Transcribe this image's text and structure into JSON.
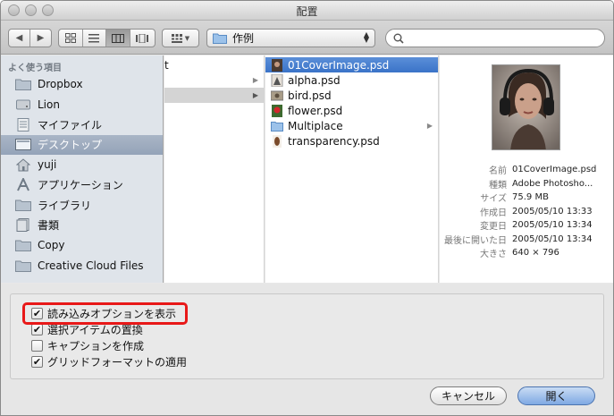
{
  "window": {
    "title": "配置"
  },
  "toolbar": {
    "path_folder": "作例",
    "search_placeholder": ""
  },
  "sidebar": {
    "header": "よく使う項目",
    "items": [
      {
        "label": "Dropbox",
        "icon": "folder-icon"
      },
      {
        "label": "Lion",
        "icon": "hard-drive-icon"
      },
      {
        "label": "マイファイル",
        "icon": "all-my-files-icon"
      },
      {
        "label": "デスクトップ",
        "icon": "desktop-icon",
        "selected": true
      },
      {
        "label": "yuji",
        "icon": "home-icon"
      },
      {
        "label": "アプリケーション",
        "icon": "applications-icon"
      },
      {
        "label": "ライブラリ",
        "icon": "folder-icon"
      },
      {
        "label": "書類",
        "icon": "documents-icon"
      },
      {
        "label": "Copy",
        "icon": "folder-icon"
      },
      {
        "label": "Creative Cloud Files",
        "icon": "folder-icon"
      }
    ]
  },
  "column1": {
    "partial_text": "t"
  },
  "column2": {
    "items": [
      {
        "label": "01CoverImage.psd",
        "icon": "psd-thumb-icon",
        "selected": true
      },
      {
        "label": "alpha.psd",
        "icon": "psd-thumb-icon"
      },
      {
        "label": "bird.psd",
        "icon": "psd-thumb-icon"
      },
      {
        "label": "flower.psd",
        "icon": "psd-thumb-icon"
      },
      {
        "label": "Multiplace",
        "icon": "folder-icon",
        "folder": true
      },
      {
        "label": "transparency.psd",
        "icon": "psd-thumb-icon"
      }
    ]
  },
  "preview": {
    "info": [
      {
        "key": "名前",
        "value": "01CoverImage.psd"
      },
      {
        "key": "種類",
        "value": "Adobe Photosho..."
      },
      {
        "key": "サイズ",
        "value": "75.9 MB"
      },
      {
        "key": "作成日",
        "value": "2005/05/10 13:33"
      },
      {
        "key": "変更日",
        "value": "2005/05/10 13:34"
      },
      {
        "key": "最後に開いた日",
        "value": "2005/05/10 13:34"
      },
      {
        "key": "大きさ",
        "value": "640 × 796"
      }
    ]
  },
  "options": [
    {
      "label": "読み込みオプションを表示",
      "checked": true
    },
    {
      "label": "選択アイテムの置換",
      "checked": true
    },
    {
      "label": "キャプションを作成",
      "checked": false
    },
    {
      "label": "グリッドフォーマットの適用",
      "checked": true
    }
  ],
  "buttons": {
    "cancel": "キャンセル",
    "open": "開く"
  },
  "colors": {
    "selection_blue": "#3a73c8",
    "sidebar_bg": "#dfe4ea",
    "highlight_red": "#e81818"
  }
}
